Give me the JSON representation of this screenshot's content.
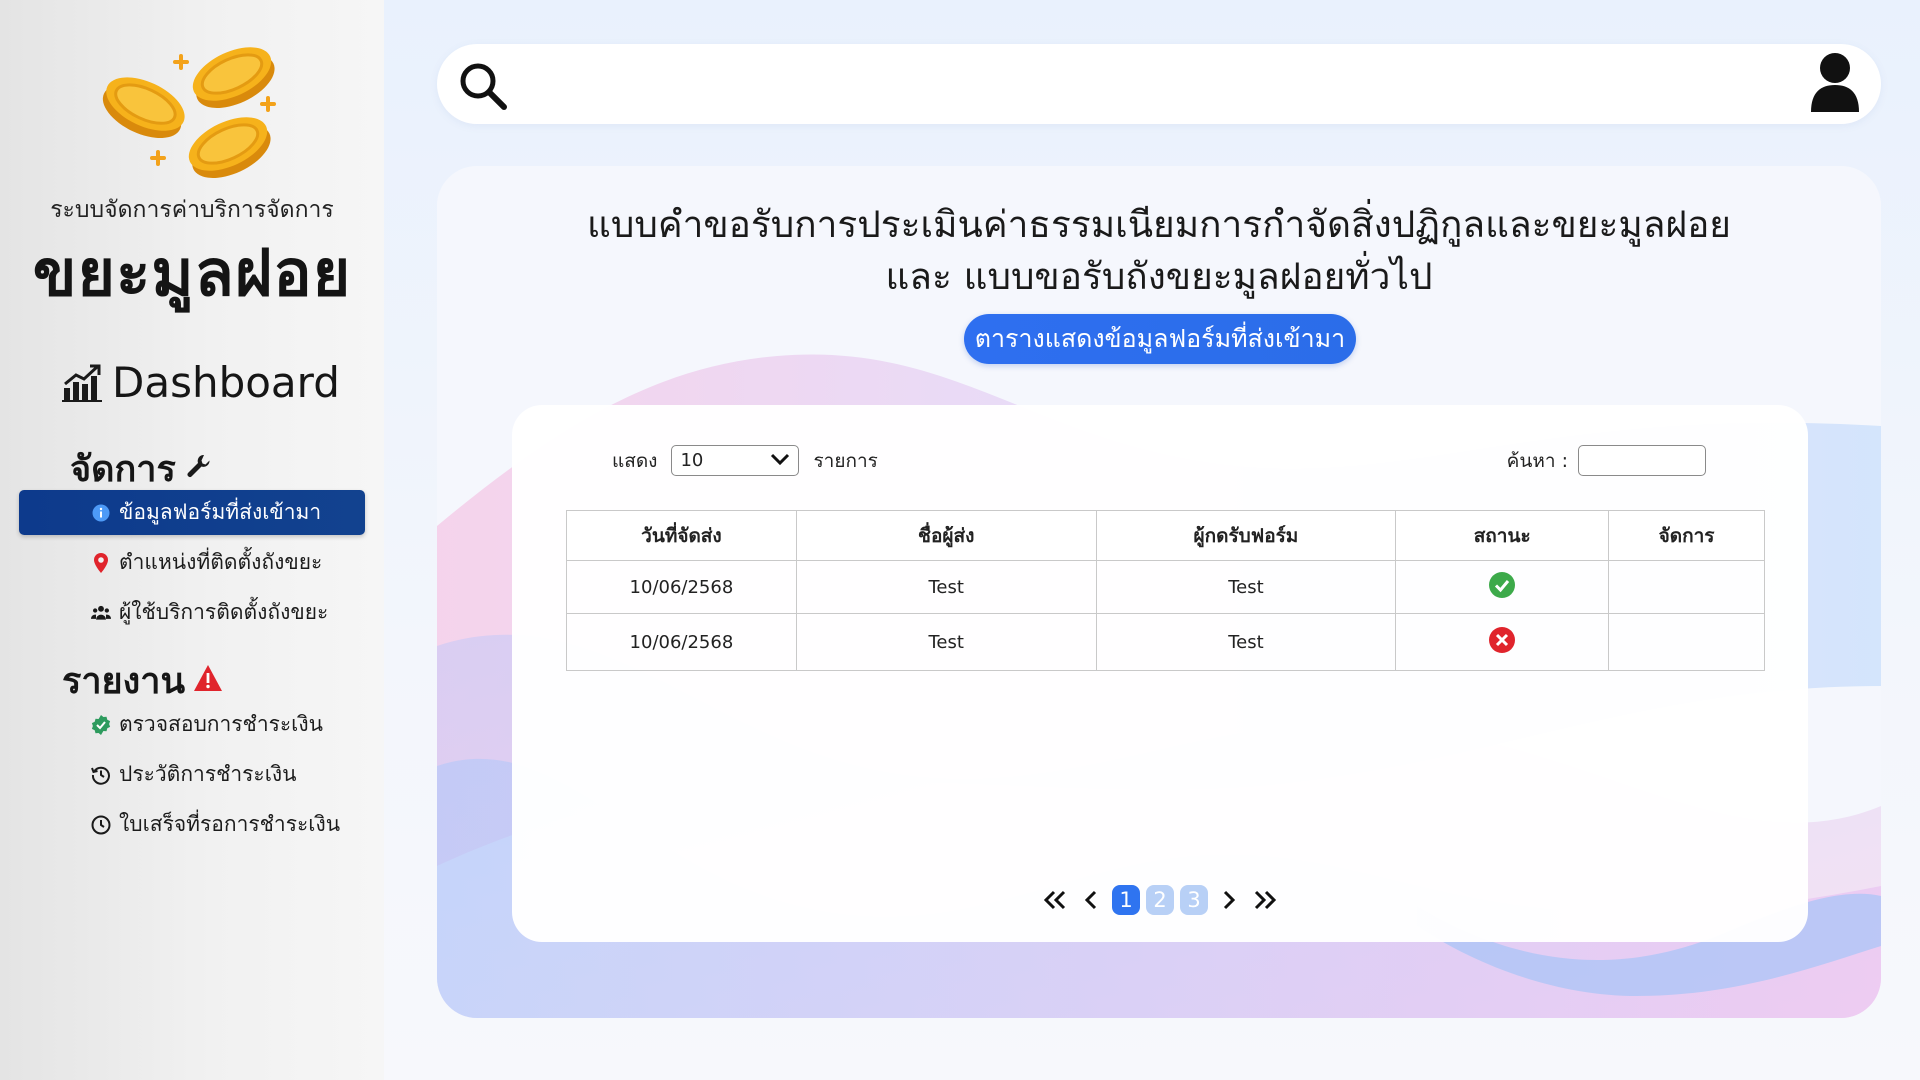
{
  "sidebar": {
    "brand_subtitle": "ระบบจัดการค่าบริการจัดการ",
    "brand_title": "ขยะมูลฝอย",
    "dashboard_label": "Dashboard",
    "manage_title": "จัดการ",
    "manage_items": [
      {
        "label": "ข้อมูลฟอร์มที่ส่งเข้ามา",
        "icon": "info-icon",
        "active": true
      },
      {
        "label": "ตำแหน่งที่ติดตั้งถังขยะ",
        "icon": "location-pin-icon",
        "active": false
      },
      {
        "label": "ผู้ใช้บริการติดตั้งถังขยะ",
        "icon": "users-icon",
        "active": false
      }
    ],
    "report_title": "รายงาน",
    "report_items": [
      {
        "label": "ตรวจสอบการชำระเงิน",
        "icon": "verified-badge-icon"
      },
      {
        "label": "ประวัติการชำระเงิน",
        "icon": "history-icon"
      },
      {
        "label": "ใบเสร็จที่รอการชำระเงิน",
        "icon": "clock-icon"
      }
    ]
  },
  "main": {
    "heading_line1": "แบบคำขอรับการประเมินค่าธรรมเนียมการกำจัดสิ่งปฏิกูลและขยะมูลฝอย",
    "heading_line2": "และ แบบขอรับถังขยะมูลฝอยทั่วไป",
    "pill_label": "ตารางแสดงข้อมูลฟอร์มที่ส่งเข้ามา"
  },
  "table": {
    "show_label": "แสดง",
    "page_size": "10",
    "entries_label": "รายการ",
    "search_label": "ค้นหา :",
    "headers": [
      "วันที่จัดส่ง",
      "ชื่อผู้ส่ง",
      "ผู้กดรับฟอร์ม",
      "สถานะ",
      "จัดการ"
    ],
    "rows": [
      {
        "date": "10/06/2568",
        "sender": "Test",
        "receiver": "Test",
        "status": "approved"
      },
      {
        "date": "10/06/2568",
        "sender": "Test",
        "receiver": "Test",
        "status": "rejected"
      }
    ]
  },
  "pagination": {
    "pages": [
      "1",
      "2",
      "3"
    ],
    "current": "1"
  },
  "colors": {
    "accent": "#2f74f0",
    "active_nav": "#0d3a8c",
    "success": "#3daa4a",
    "danger": "#e0242c"
  }
}
